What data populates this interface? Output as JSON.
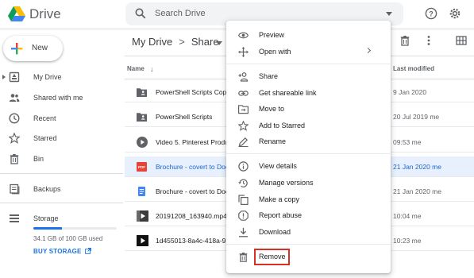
{
  "app": {
    "name": "Drive"
  },
  "search": {
    "placeholder": "Search Drive"
  },
  "sidebar": {
    "new_label": "New",
    "items": [
      {
        "label": "My Drive",
        "icon": "my-drive-icon"
      },
      {
        "label": "Shared with me",
        "icon": "people-icon"
      },
      {
        "label": "Recent",
        "icon": "clock-icon"
      },
      {
        "label": "Starred",
        "icon": "star-icon"
      },
      {
        "label": "Bin",
        "icon": "trash-icon"
      },
      {
        "label": "Backups",
        "icon": "backup-icon"
      },
      {
        "label": "Storage",
        "icon": "storage-icon"
      }
    ],
    "storage_text": "34.1 GB of 100 GB used",
    "storage_fraction": 0.341,
    "buy_storage": "BUY STORAGE"
  },
  "breadcrumb": {
    "root": "My Drive",
    "sep": ">",
    "current": "Share"
  },
  "columns": {
    "name": "Name",
    "sort_arrow": "↓",
    "modified": "Last modified"
  },
  "files": [
    {
      "name": "PowerShell Scripts Cop",
      "modified": "9 Jan 2020",
      "icon": "shared-folder-icon",
      "selected": false
    },
    {
      "name": "PowerShell Scripts",
      "modified": "20 Jul 2019 me",
      "icon": "shared-folder-icon",
      "selected": false
    },
    {
      "name": "Video 5. Pinterest Produ",
      "modified": "09:53 me",
      "icon": "video-icon",
      "selected": false
    },
    {
      "name": "Brochure - covert to Doc",
      "modified": "21 Jan 2020 me",
      "icon": "pdf-icon",
      "selected": true
    },
    {
      "name": "Brochure - covert to Doc",
      "modified": "21 Jan 2020 me",
      "icon": "doc-icon",
      "selected": false
    },
    {
      "name": "20191208_163940.mp4",
      "modified": "10:04 me",
      "icon": "video-thumb-icon",
      "selected": false
    },
    {
      "name": "1d455013-8a4c-418a-9",
      "modified": "10:23 me",
      "icon": "video-thumb-icon",
      "selected": false
    }
  ],
  "context_menu": {
    "groups": [
      [
        {
          "label": "Preview",
          "icon": "eye-icon"
        },
        {
          "label": "Open with",
          "icon": "open-with-icon",
          "submenu": true
        }
      ],
      [
        {
          "label": "Share",
          "icon": "add-person-icon"
        },
        {
          "label": "Get shareable link",
          "icon": "link-icon"
        },
        {
          "label": "Move to",
          "icon": "move-folder-icon"
        },
        {
          "label": "Add to Starred",
          "icon": "star-icon"
        },
        {
          "label": "Rename",
          "icon": "pencil-icon"
        }
      ],
      [
        {
          "label": "View details",
          "icon": "info-icon"
        },
        {
          "label": "Manage versions",
          "icon": "history-icon"
        },
        {
          "label": "Make a copy",
          "icon": "copy-icon"
        },
        {
          "label": "Report abuse",
          "icon": "report-icon"
        },
        {
          "label": "Download",
          "icon": "download-icon"
        }
      ],
      [
        {
          "label": "Remove",
          "icon": "trash-icon",
          "highlighted": true
        }
      ]
    ]
  },
  "colors": {
    "accent": "#1a73e8",
    "selected_row": "#e8f0fe",
    "highlight_border": "#d93025"
  }
}
